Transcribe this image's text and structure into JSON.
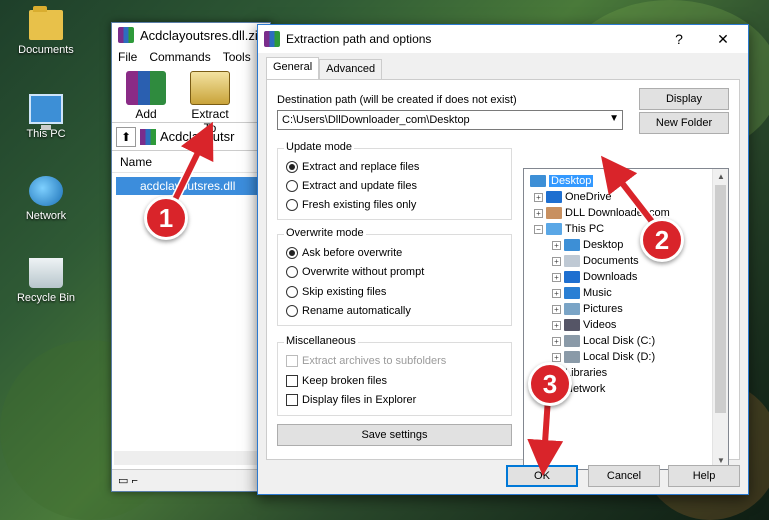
{
  "desktop": {
    "icons": [
      {
        "label": "Documents"
      },
      {
        "label": "This PC"
      },
      {
        "label": "Network"
      },
      {
        "label": "Recycle Bin"
      }
    ]
  },
  "winrar": {
    "title": "Acdclayoutsres.dll.zi",
    "menu": [
      "File",
      "Commands",
      "Tools"
    ],
    "tools": [
      {
        "label": "Add"
      },
      {
        "label": "Extract To"
      }
    ],
    "path": "Acdclayoutsr",
    "column_name": "Name",
    "selected_file": "acdclayoutsres.dll"
  },
  "dialog": {
    "title": "Extraction path and options",
    "help_glyph": "?",
    "close_glyph": "✕",
    "tabs": [
      {
        "label": "General"
      },
      {
        "label": "Advanced"
      }
    ],
    "destination_label": "Destination path (will be created if does not exist)",
    "destination_value": "C:\\Users\\DllDownloader_com\\Desktop",
    "display_button": "Display",
    "new_folder_button": "New Folder",
    "update_mode": {
      "title": "Update mode",
      "options": [
        "Extract and replace files",
        "Extract and update files",
        "Fresh existing files only"
      ],
      "selected": 0
    },
    "overwrite_mode": {
      "title": "Overwrite mode",
      "options": [
        "Ask before overwrite",
        "Overwrite without prompt",
        "Skip existing files",
        "Rename automatically"
      ],
      "selected": 0
    },
    "misc": {
      "title": "Miscellaneous",
      "options": [
        {
          "label": "Extract archives to subfolders",
          "checked": false,
          "disabled": true
        },
        {
          "label": "Keep broken files",
          "checked": false,
          "disabled": false
        },
        {
          "label": "Display files in Explorer",
          "checked": false,
          "disabled": false
        }
      ]
    },
    "save_settings_button": "Save settings",
    "tree": [
      {
        "label": "Desktop",
        "selected": true,
        "level": 0,
        "icon": "desktop-icon",
        "color": "#3d8fd6"
      },
      {
        "label": "OneDrive",
        "level": 0,
        "icon": "cloud-icon",
        "color": "#1e6fd0"
      },
      {
        "label": "DLL Downloader.com",
        "level": 0,
        "icon": "user-icon",
        "color": "#c89060"
      },
      {
        "label": "This PC",
        "level": 0,
        "icon": "pc-icon",
        "color": "#5aa7e6",
        "expanded": true
      },
      {
        "label": "Desktop",
        "level": 1,
        "icon": "desktop-icon",
        "color": "#3d8fd6"
      },
      {
        "label": "Documents",
        "level": 1,
        "icon": "documents-icon",
        "color": "#bfc9d4"
      },
      {
        "label": "Downloads",
        "level": 1,
        "icon": "download-icon",
        "color": "#1e6fd0"
      },
      {
        "label": "Music",
        "level": 1,
        "icon": "music-icon",
        "color": "#2a7fd4"
      },
      {
        "label": "Pictures",
        "level": 1,
        "icon": "pictures-icon",
        "color": "#7aa4c6"
      },
      {
        "label": "Videos",
        "level": 1,
        "icon": "videos-icon",
        "color": "#556"
      },
      {
        "label": "Local Disk (C:)",
        "level": 1,
        "icon": "disk-icon",
        "color": "#8a9aa8"
      },
      {
        "label": "Local Disk (D:)",
        "level": 1,
        "icon": "disk-icon",
        "color": "#8a9aa8"
      },
      {
        "label": "Libraries",
        "level": 0,
        "icon": "libraries-icon",
        "color": "#e8c14a"
      },
      {
        "label": "Network",
        "level": 0,
        "icon": "network-icon",
        "color": "#4a8fd6"
      }
    ],
    "ok_button": "OK",
    "cancel_button": "Cancel",
    "help_button": "Help"
  },
  "callouts": [
    "1",
    "2",
    "3"
  ],
  "accent_color": "#d9242a"
}
